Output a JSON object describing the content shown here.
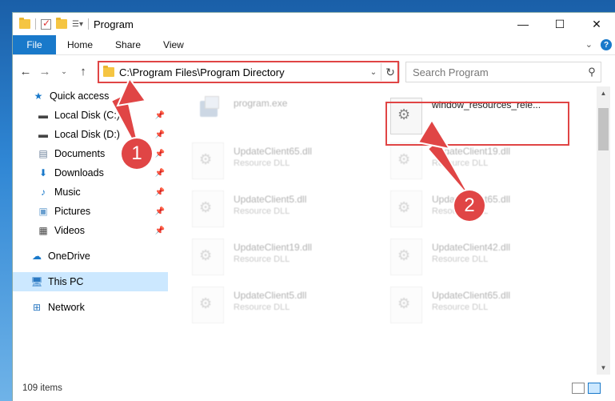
{
  "window": {
    "title": "Program",
    "controls": {
      "minimize": "—",
      "maximize": "☐",
      "close": "✕"
    }
  },
  "ribbon": {
    "tabs": [
      "File",
      "Home",
      "Share",
      "View"
    ]
  },
  "navbar": {
    "address": "C:\\Program Files\\Program Directory",
    "search_placeholder": "Search Program"
  },
  "sidebar": {
    "items": [
      {
        "label": "Quick access",
        "icon": "star-icon"
      },
      {
        "label": "Local Disk (C:)",
        "icon": "drive-icon",
        "pinned": true
      },
      {
        "label": "Local Disk (D:)",
        "icon": "drive-icon",
        "pinned": true
      },
      {
        "label": "Documents",
        "icon": "documents-icon",
        "pinned": true
      },
      {
        "label": "Downloads",
        "icon": "download-icon",
        "pinned": true
      },
      {
        "label": "Music",
        "icon": "music-icon",
        "pinned": true
      },
      {
        "label": "Pictures",
        "icon": "pictures-icon",
        "pinned": true
      },
      {
        "label": "Videos",
        "icon": "videos-icon",
        "pinned": true
      },
      {
        "label": "OneDrive",
        "icon": "cloud-icon"
      },
      {
        "label": "This PC",
        "icon": "computer-icon",
        "selected": true
      },
      {
        "label": "Network",
        "icon": "network-icon"
      }
    ]
  },
  "files": [
    {
      "name": "program.exe",
      "type": ""
    },
    {
      "name": "window_resources_rele...",
      "type": ""
    },
    {
      "name": "UpdateClient65.dll",
      "type": "Resource DLL"
    },
    {
      "name": "UpdateClient19.dll",
      "type": "Resource DLL"
    },
    {
      "name": "UpdateClient5.dll",
      "type": "Resource DLL"
    },
    {
      "name": "UpdateClient65.dll",
      "type": "Resource DLL"
    },
    {
      "name": "UpdateClient19.dll",
      "type": "Resource DLL"
    },
    {
      "name": "UpdateClient42.dll",
      "type": "Resource DLL"
    },
    {
      "name": "UpdateClient5.dll",
      "type": "Resource DLL"
    },
    {
      "name": "UpdateClient65.dll",
      "type": "Resource DLL"
    }
  ],
  "status": {
    "item_count": "109 items"
  },
  "annotations": {
    "step1": "1",
    "step2": "2",
    "color": "#e04545"
  },
  "colors": {
    "accent": "#1979ca",
    "selected_bg": "#cce8ff"
  }
}
